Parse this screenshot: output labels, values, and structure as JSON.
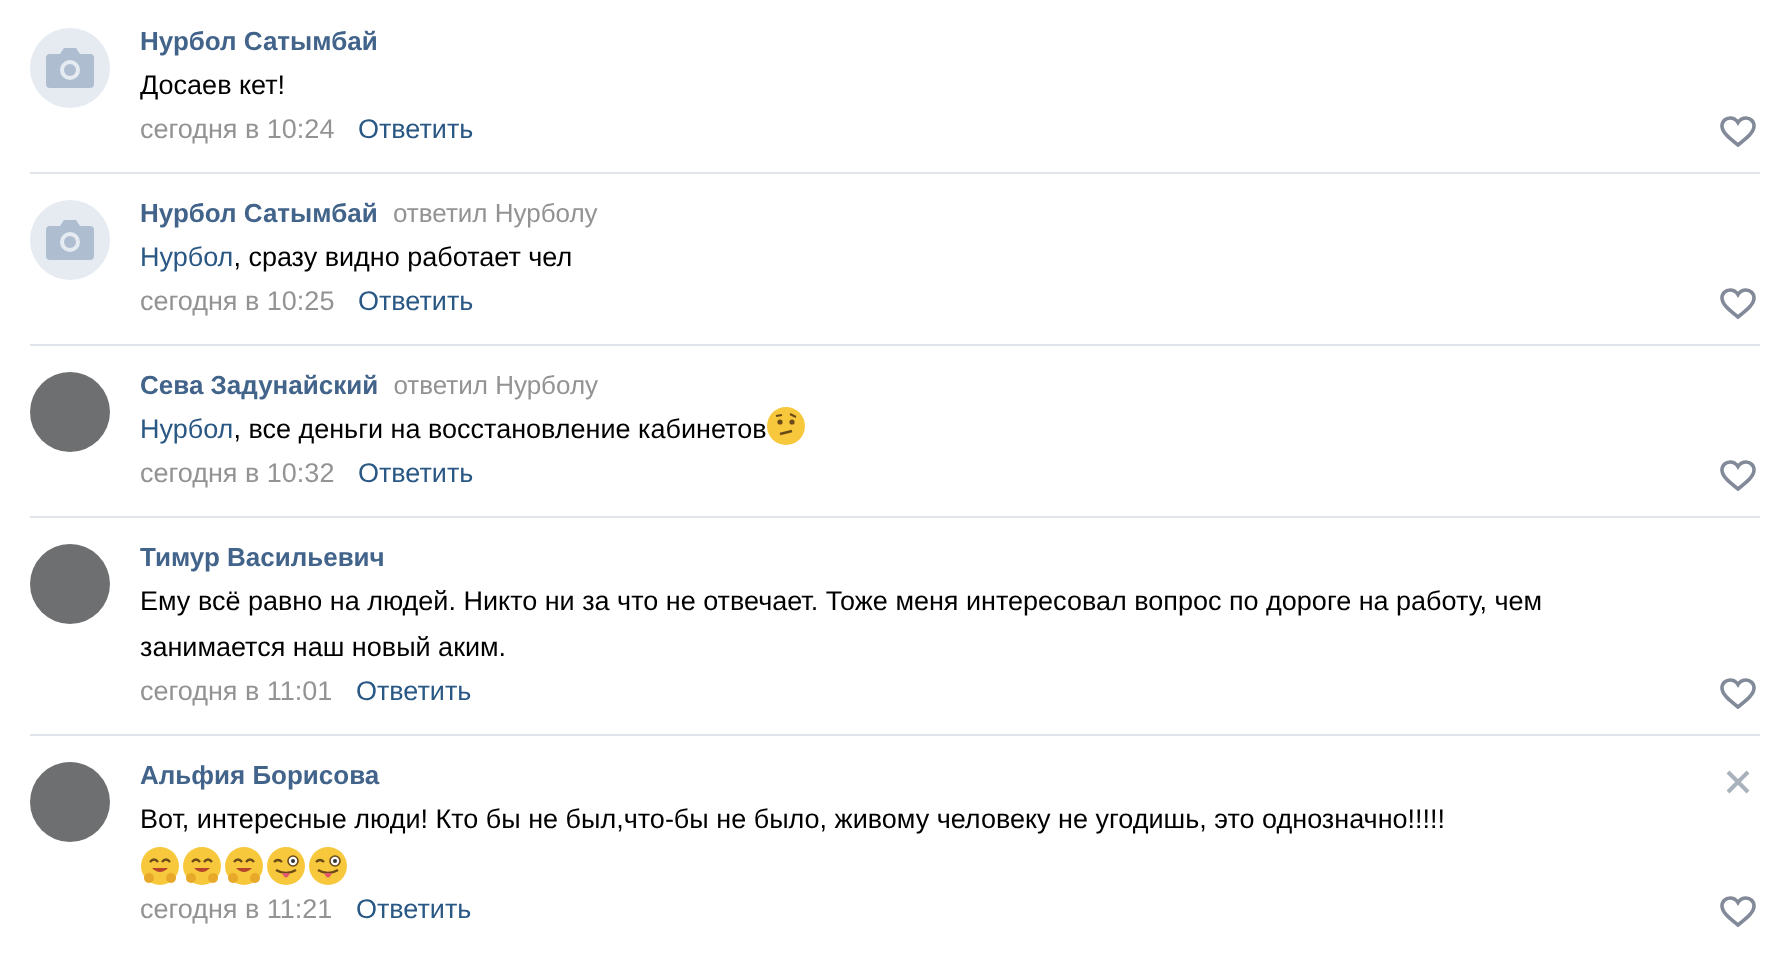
{
  "comments": [
    {
      "author": "Нурбол Сатымбай",
      "avatar": {
        "kind": "camera"
      },
      "text": "Досаев кет!",
      "time": "сегодня в 10:24",
      "reply_link": "Ответить",
      "close_shown": false
    },
    {
      "author": "Нурбол Сатымбай",
      "avatar": {
        "kind": "camera"
      },
      "replied_to": "ответил Нурболу",
      "mention": "Нурбол",
      "text": ", сразу видно работает чел",
      "time": "сегодня в 10:25",
      "reply_link": "Ответить",
      "close_shown": false
    },
    {
      "author": "Сева Задунайский",
      "avatar": {
        "kind": "photo"
      },
      "replied_to": "ответил Нурболу",
      "mention": "Нурбол",
      "text": ", все деньги на восстановление кабинетов",
      "emojis": [
        {
          "kind": "thinking"
        }
      ],
      "time": "сегодня в 10:32",
      "reply_link": "Ответить",
      "close_shown": false
    },
    {
      "author": "Тимур Васильевич",
      "avatar": {
        "kind": "photo"
      },
      "text": "Ему всё равно на людей. Никто ни за что не отвечает. Тоже меня интересовал вопрос по дороге на работу, чем занимается наш новый аким.",
      "time": "сегодня в 11:01",
      "reply_link": "Ответить",
      "close_shown": false
    },
    {
      "author": "Альфия Борисова",
      "avatar": {
        "kind": "photo"
      },
      "text": "Вот, интересные люди! Кто бы не был,что-бы не было, живому человеку не угодишь, это однозначно!!!!!",
      "emojis": [
        {
          "kind": "hugging"
        },
        {
          "kind": "hugging"
        },
        {
          "kind": "hugging"
        },
        {
          "kind": "wink-tongue"
        },
        {
          "kind": "wink-tongue"
        }
      ],
      "time": "сегодня в 11:21",
      "reply_link": "Ответить",
      "close_shown": true
    }
  ]
}
